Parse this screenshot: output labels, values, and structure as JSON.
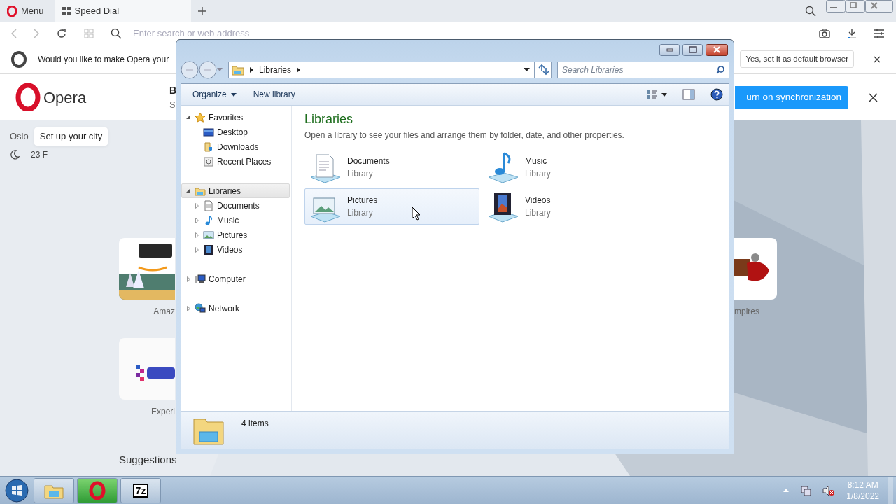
{
  "browser": {
    "tabs": [
      {
        "kind": "menu",
        "label": "Menu",
        "selected": false
      },
      {
        "kind": "page",
        "label": "Speed Dial",
        "selected": true
      }
    ],
    "address": {
      "placeholder": "Enter search or web address"
    },
    "default_prompt": {
      "text": "Would you like to make Opera your",
      "button": "Yes, set it as default browser"
    },
    "header": {
      "logo": "Opera",
      "fragment_1": "B",
      "fragment_2": "S",
      "sync_button": "urn on synchronization"
    },
    "weather": {
      "city": "Oslo",
      "tooltip": "Set up your city",
      "temperature": "23 F"
    },
    "speed_dial": [
      {
        "kind": "picture",
        "label": "Amaz"
      },
      {
        "kind": "picture",
        "label": "mpires"
      },
      {
        "kind": "picture",
        "label": "Experi"
      }
    ],
    "suggestions": "Suggestions"
  },
  "explorer": {
    "breadcrumb": "Libraries",
    "search": {
      "placeholder": "Search Libraries"
    },
    "toolbar": [
      {
        "kind": "menu",
        "label": "Organize"
      },
      {
        "kind": "button",
        "label": "New library"
      }
    ],
    "tree": [
      {
        "kind": "star",
        "label": "Favorites",
        "expanded": true,
        "selected": false,
        "children": [
          {
            "kind": "desktop",
            "label": "Desktop",
            "selected": false
          },
          {
            "kind": "downloads",
            "label": "Downloads",
            "selected": false
          },
          {
            "kind": "recent",
            "label": "Recent Places",
            "selected": false
          }
        ]
      },
      {
        "kind": "library",
        "label": "Libraries",
        "expanded": true,
        "selected": true,
        "children": [
          {
            "kind": "documents",
            "label": "Documents",
            "expanded": false,
            "selected": false
          },
          {
            "kind": "music",
            "label": "Music",
            "expanded": false,
            "selected": false
          },
          {
            "kind": "pictures",
            "label": "Pictures",
            "expanded": false,
            "selected": false
          },
          {
            "kind": "videos",
            "label": "Videos",
            "expanded": false,
            "selected": false
          }
        ]
      },
      {
        "kind": "computer",
        "label": "Computer",
        "expanded": false,
        "selected": false
      },
      {
        "kind": "network",
        "label": "Network",
        "expanded": false,
        "selected": false
      }
    ],
    "heading": "Libraries",
    "description": "Open a library to see your files and arrange them by folder, date, and other properties.",
    "libraries": [
      {
        "kind": "documents",
        "name": "Documents",
        "type": "Library",
        "hovered": false
      },
      {
        "kind": "music",
        "name": "Music",
        "type": "Library",
        "hovered": false
      },
      {
        "kind": "pictures",
        "name": "Pictures",
        "type": "Library",
        "hovered": true
      },
      {
        "kind": "videos",
        "name": "Videos",
        "type": "Library",
        "hovered": false
      }
    ],
    "status": "4 items"
  },
  "taskbar": {
    "apps": [
      {
        "kind": "explorer",
        "active": false
      },
      {
        "kind": "opera",
        "active": true
      },
      {
        "kind": "archiver",
        "label": "7z",
        "active": false
      }
    ],
    "time": "8:12 AM",
    "date": "1/8/2022"
  }
}
